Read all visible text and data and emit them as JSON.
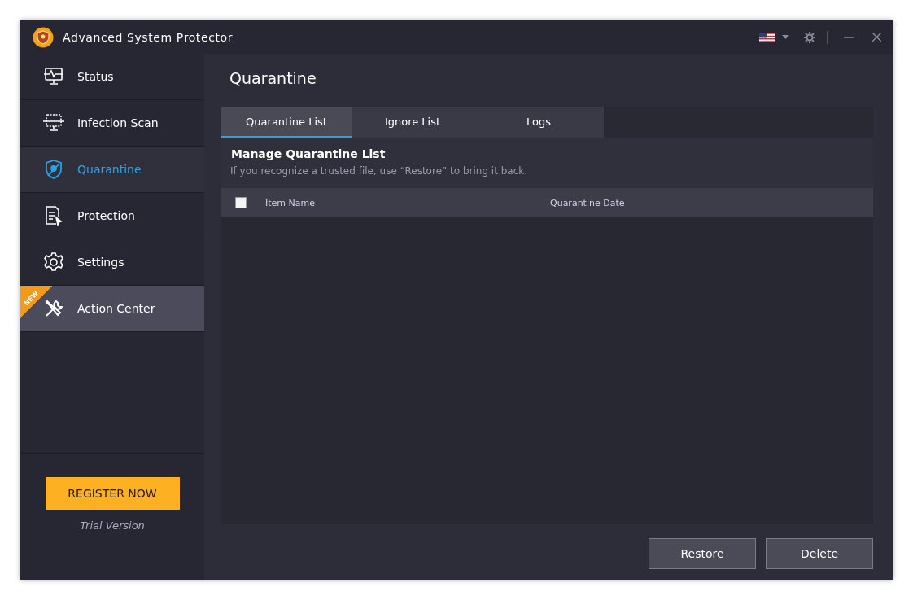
{
  "window": {
    "title": "Advanced System Protector"
  },
  "sidebar": {
    "items": [
      {
        "label": "Status",
        "kind": "monitor-pulse",
        "selected": false,
        "highlighted": false
      },
      {
        "label": "Infection Scan",
        "kind": "monitor-scan",
        "selected": false,
        "highlighted": false
      },
      {
        "label": "Quarantine",
        "kind": "shield",
        "selected": true,
        "highlighted": false
      },
      {
        "label": "Protection",
        "kind": "document",
        "selected": false,
        "highlighted": false
      },
      {
        "label": "Settings",
        "kind": "gear",
        "selected": false,
        "highlighted": false
      },
      {
        "label": "Action Center",
        "kind": "tools",
        "selected": false,
        "highlighted": true,
        "badge": "NEW"
      }
    ],
    "register_button": "REGISTER NOW",
    "version": "Trial Version"
  },
  "page": {
    "title": "Quarantine",
    "tabs": [
      {
        "label": "Quarantine List",
        "selected": true
      },
      {
        "label": "Ignore List",
        "selected": false
      },
      {
        "label": "Logs",
        "selected": false
      }
    ],
    "heading": "Manage Quarantine List",
    "hint": "If you recognize a trusted file, use “Restore” to bring it back.",
    "table": {
      "select_all": {
        "checked": false
      },
      "columns": [
        "Item Name",
        "Quarantine Date"
      ]
    },
    "buttons": [
      "Restore",
      "Delete"
    ]
  }
}
